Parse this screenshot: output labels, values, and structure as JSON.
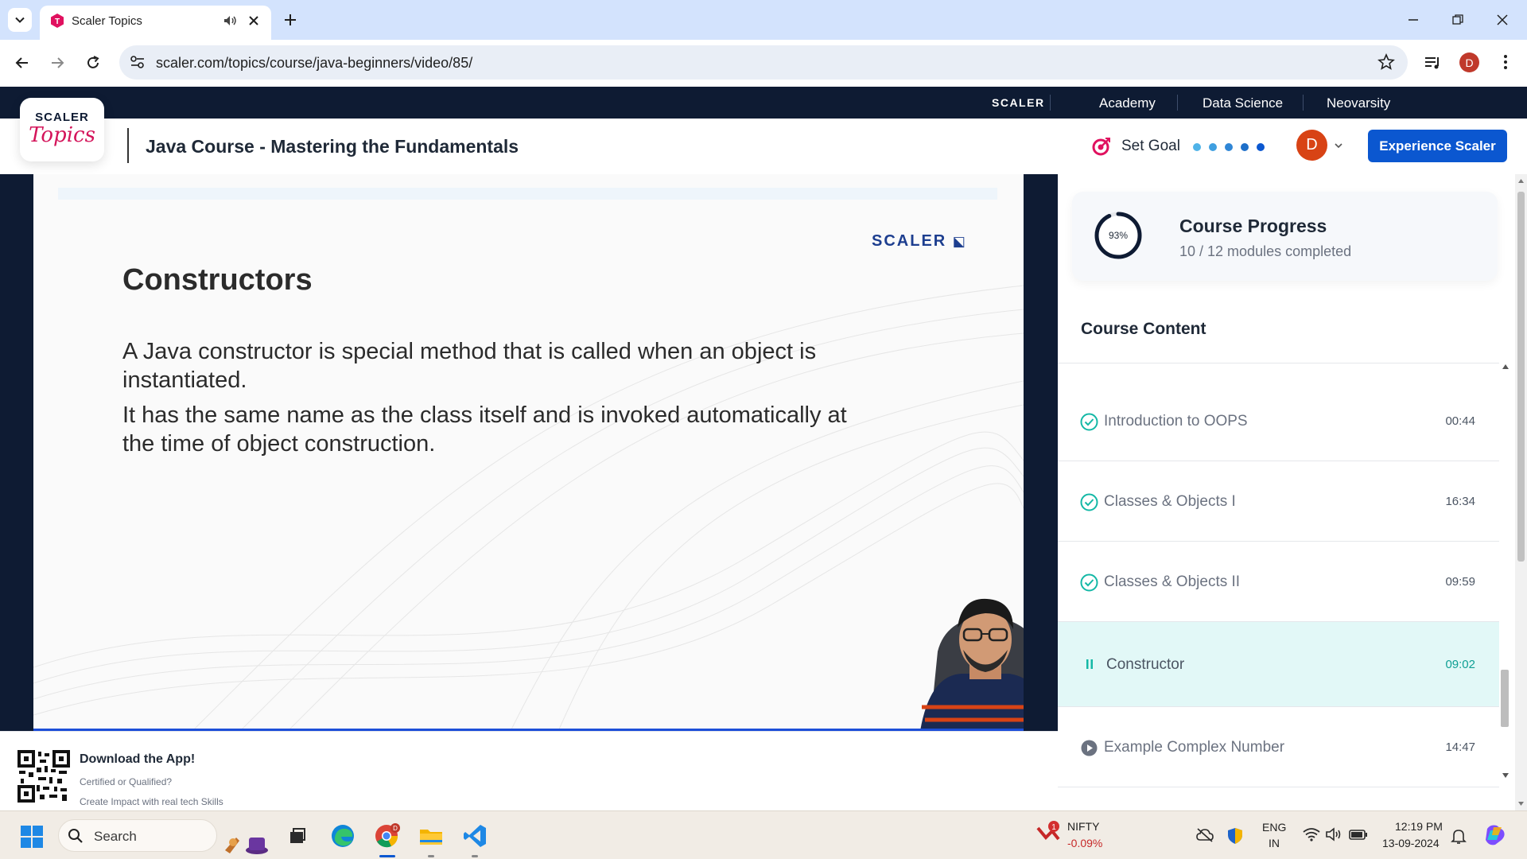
{
  "browser": {
    "tab_title": "Scaler Topics",
    "url": "scaler.com/topics/course/java-beginners/video/85/",
    "profile_initial": "D"
  },
  "site": {
    "topnav": {
      "brand": "SCALER",
      "items": [
        "Academy",
        "Data Science",
        "Neovarsity"
      ]
    },
    "logo": {
      "line1": "SCALER",
      "line2": "Topics"
    },
    "course_title": "Java Course - Mastering the Fundamentals",
    "set_goal_label": "Set Goal",
    "user_initial": "D",
    "cta_label": "Experience Scaler",
    "colors": {
      "brand_blue": "#0b57d0",
      "accent_teal": "#0e9f94",
      "nav_dark": "#0e1b33"
    }
  },
  "video": {
    "brand": "SCALER",
    "slide_title": "Constructors",
    "paragraph_1": "A Java constructor is special method that is called when an object is instantiated.",
    "paragraph_2": "It has the same name as the class itself and is invoked automatically at the time of object construction."
  },
  "app_banner": {
    "title": "Download the App!",
    "line1": "Certified or Qualified?",
    "line2": "Create Impact with real tech Skills"
  },
  "sidebar": {
    "progress": {
      "percent_label": "93%",
      "percent": 93,
      "title": "Course Progress",
      "subtitle": "10 / 12 modules completed"
    },
    "content_title": "Course Content",
    "lessons": [
      {
        "title": "Introduction to OOPS",
        "duration": "00:44",
        "status": "completed"
      },
      {
        "title": "Classes & Objects I",
        "duration": "16:34",
        "status": "completed"
      },
      {
        "title": "Classes & Objects II",
        "duration": "09:59",
        "status": "completed"
      },
      {
        "title": "Constructor",
        "duration": "09:02",
        "status": "playing"
      },
      {
        "title": "Example Complex Number",
        "duration": "14:47",
        "status": "not-started"
      }
    ]
  },
  "taskbar": {
    "search_label": "Search",
    "nifty_badge": "1",
    "nifty_name": "NIFTY",
    "nifty_change": "-0.09%",
    "language_1": "ENG",
    "language_2": "IN",
    "time": "12:19 PM",
    "date": "13-09-2024",
    "chrome_badge": "D"
  }
}
